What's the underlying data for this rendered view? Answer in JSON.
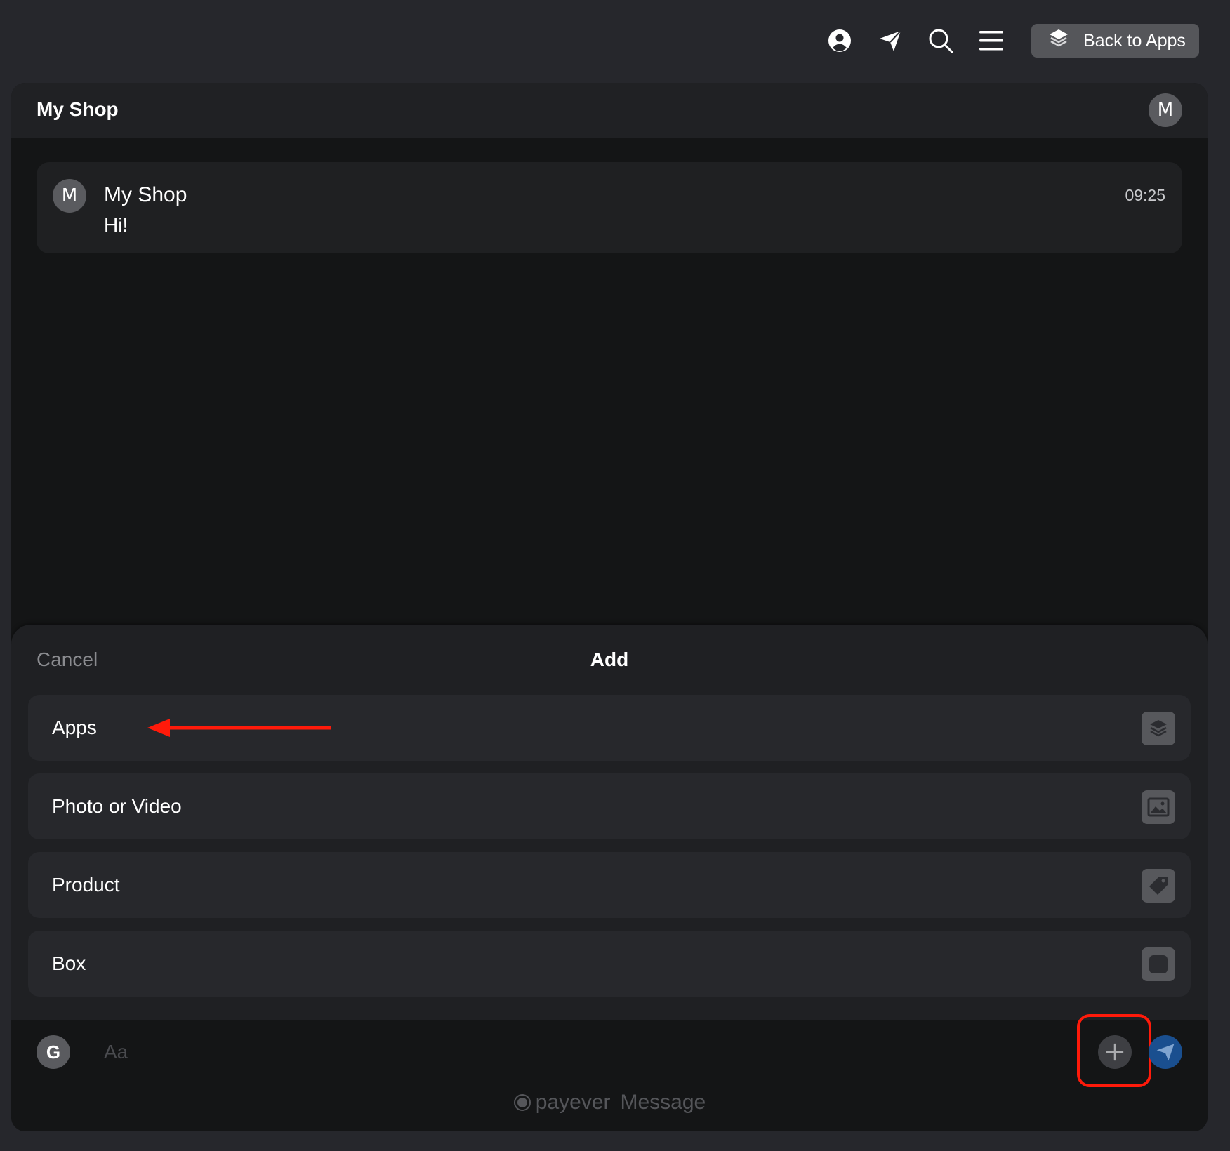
{
  "topbar": {
    "icons": [
      "account-icon",
      "send-plane-icon",
      "search-icon",
      "menu-icon"
    ],
    "back_to_apps_label": "Back to Apps"
  },
  "window": {
    "title": "My Shop",
    "header_avatar_letter": "M"
  },
  "message": {
    "avatar_letter": "M",
    "sender": "My Shop",
    "text": "Hi!",
    "time": "09:25"
  },
  "add_sheet": {
    "cancel_label": "Cancel",
    "title": "Add",
    "items": [
      {
        "label": "Apps",
        "icon": "layers-icon"
      },
      {
        "label": "Photo or Video",
        "icon": "image-icon"
      },
      {
        "label": "Product",
        "icon": "tag-icon"
      },
      {
        "label": "Box",
        "icon": "box-icon"
      }
    ]
  },
  "composer": {
    "avatar_letter": "G",
    "placeholder": "Aa"
  },
  "branding": {
    "name": "payever",
    "suffix": "Message"
  },
  "colors": {
    "background": "#26272c",
    "window": "#141516",
    "sheet": "#1f2023",
    "item": "#27282c",
    "highlight": "#ff1a0a",
    "send_button": "#1a4f8f"
  }
}
